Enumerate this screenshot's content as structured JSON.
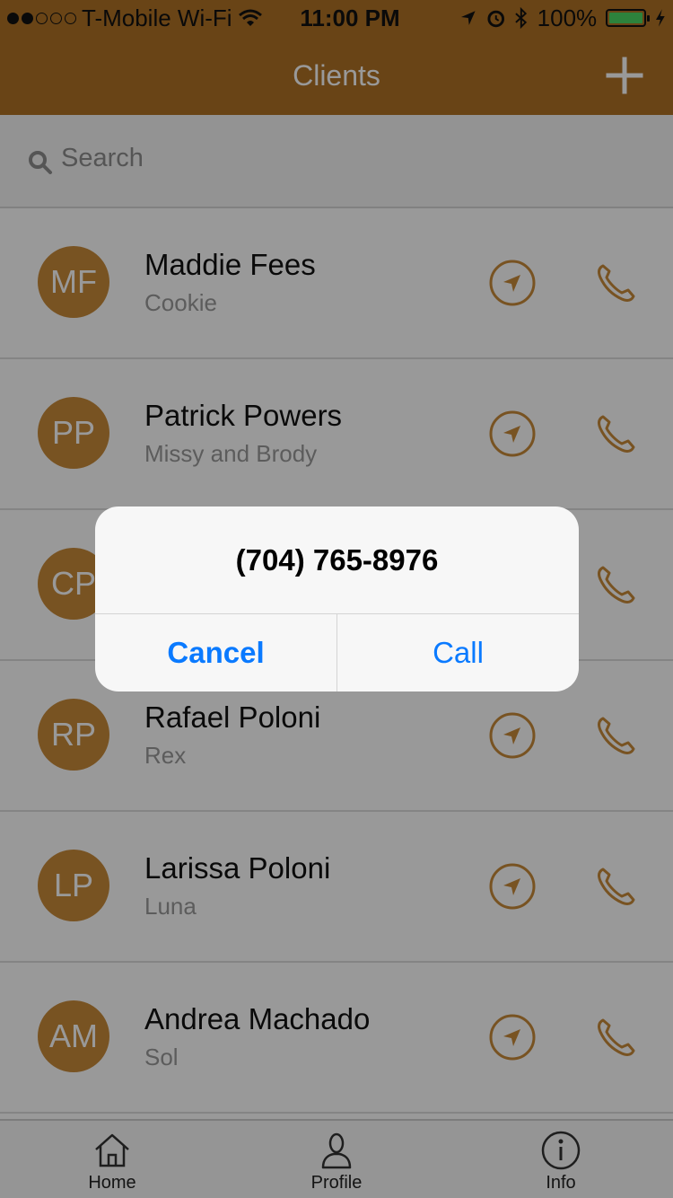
{
  "status_bar": {
    "carrier": "T-Mobile Wi-Fi",
    "time": "11:00 PM",
    "battery": "100%",
    "signal_bars_filled": 2,
    "signal_bars_total": 5
  },
  "nav": {
    "title": "Clients",
    "add_icon": "plus-icon"
  },
  "search": {
    "placeholder": "Search"
  },
  "clients": [
    {
      "initials": "MF",
      "name": "Maddie Fees",
      "pets": "Cookie"
    },
    {
      "initials": "PP",
      "name": "Patrick Powers",
      "pets": "Missy and Brody"
    },
    {
      "initials": "CP",
      "name": "",
      "pets": ""
    },
    {
      "initials": "RP",
      "name": "Rafael Poloni",
      "pets": "Rex"
    },
    {
      "initials": "LP",
      "name": "Larissa Poloni",
      "pets": "Luna"
    },
    {
      "initials": "AM",
      "name": "Andrea Machado",
      "pets": "Sol"
    }
  ],
  "tabs": [
    {
      "label": "Home",
      "icon": "home-icon"
    },
    {
      "label": "Profile",
      "icon": "profile-icon"
    },
    {
      "label": "Info",
      "icon": "info-icon"
    }
  ],
  "alert": {
    "title": "(704) 765-8976",
    "cancel": "Cancel",
    "confirm": "Call"
  },
  "colors": {
    "brand": "#b07226",
    "avatar": "#c98a3a",
    "link": "#0a7aff"
  }
}
